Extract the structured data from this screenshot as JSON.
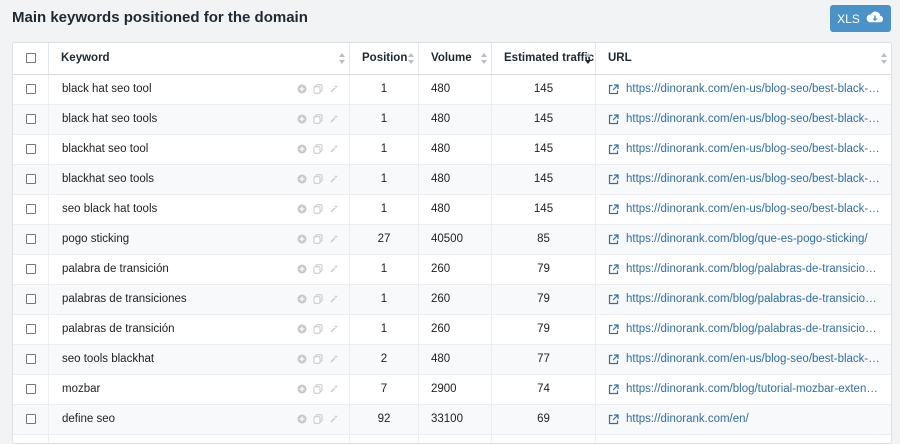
{
  "page": {
    "title": "Main keywords positioned for the domain"
  },
  "export_button": {
    "label": "XLS",
    "icon": "cloud-download-icon"
  },
  "table": {
    "headers": {
      "keyword": "Keyword",
      "position": "Position",
      "volume": "Volume",
      "traffic": "Estimated traffic",
      "url": "URL"
    },
    "rows": [
      {
        "keyword": "black hat seo tool",
        "position": "1",
        "volume": "480",
        "traffic": "145",
        "url": "https://dinorank.com/en-us/blog-seo/best-black-hat-s..."
      },
      {
        "keyword": "black hat seo tools",
        "position": "1",
        "volume": "480",
        "traffic": "145",
        "url": "https://dinorank.com/en-us/blog-seo/best-black-hat-s..."
      },
      {
        "keyword": "blackhat seo tool",
        "position": "1",
        "volume": "480",
        "traffic": "145",
        "url": "https://dinorank.com/en-us/blog-seo/best-black-hat-s..."
      },
      {
        "keyword": "blackhat seo tools",
        "position": "1",
        "volume": "480",
        "traffic": "145",
        "url": "https://dinorank.com/en-us/blog-seo/best-black-hat-s..."
      },
      {
        "keyword": "seo black hat tools",
        "position": "1",
        "volume": "480",
        "traffic": "145",
        "url": "https://dinorank.com/en-us/blog-seo/best-black-hat-s..."
      },
      {
        "keyword": "pogo sticking",
        "position": "27",
        "volume": "40500",
        "traffic": "85",
        "url": "https://dinorank.com/blog/que-es-pogo-sticking/"
      },
      {
        "keyword": "palabra de transición",
        "position": "1",
        "volume": "260",
        "traffic": "79",
        "url": "https://dinorank.com/blog/palabras-de-transicion-seo/"
      },
      {
        "keyword": "palabras de transiciones",
        "position": "1",
        "volume": "260",
        "traffic": "79",
        "url": "https://dinorank.com/blog/palabras-de-transicion-seo/"
      },
      {
        "keyword": "palabras de transición",
        "position": "1",
        "volume": "260",
        "traffic": "79",
        "url": "https://dinorank.com/blog/palabras-de-transicion-seo/"
      },
      {
        "keyword": "seo tools blackhat",
        "position": "2",
        "volume": "480",
        "traffic": "77",
        "url": "https://dinorank.com/en-us/blog-seo/best-black-hat-s..."
      },
      {
        "keyword": "mozbar",
        "position": "7",
        "volume": "2900",
        "traffic": "74",
        "url": "https://dinorank.com/blog/tutorial-mozbar-extension/"
      },
      {
        "keyword": "define seo",
        "position": "92",
        "volume": "33100",
        "traffic": "69",
        "url": "https://dinorank.com/en/"
      },
      {
        "keyword": "",
        "position": "",
        "volume": "",
        "traffic": "",
        "url": ""
      }
    ]
  },
  "colors": {
    "accent": "#4a93c9",
    "link": "#2f6fa7"
  }
}
